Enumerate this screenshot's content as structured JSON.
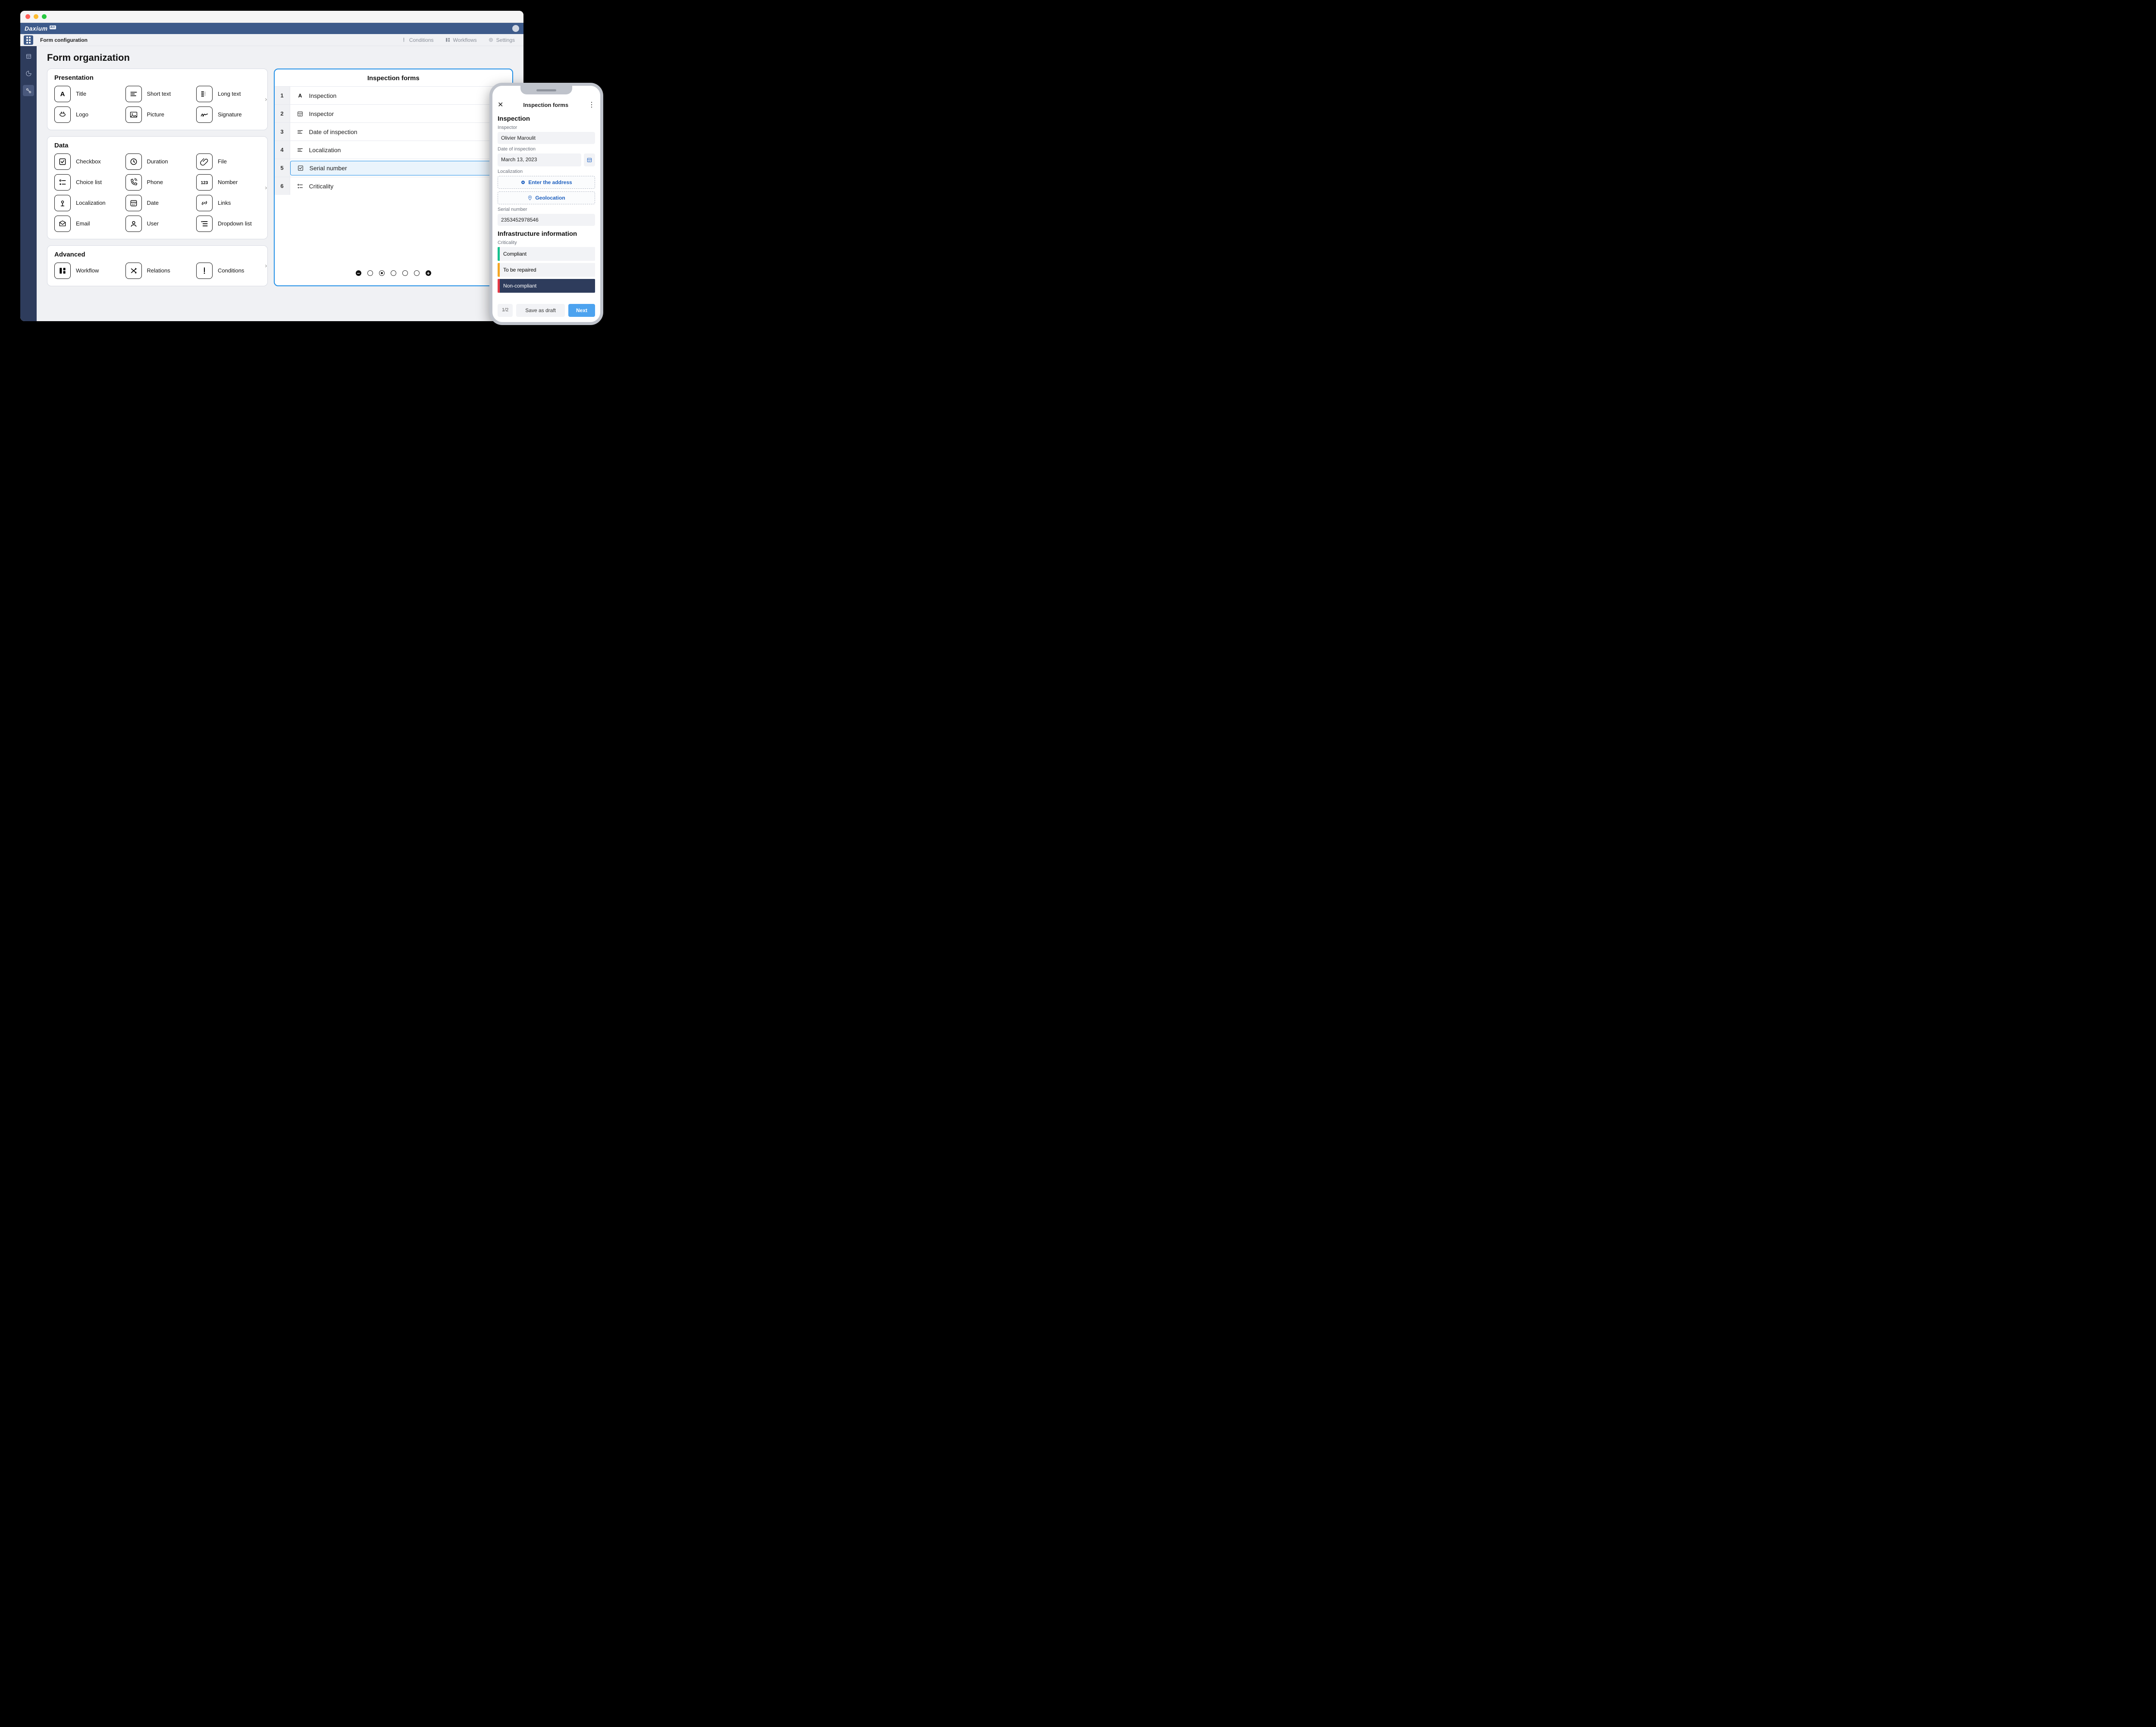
{
  "brand": {
    "name": "Daxium",
    "badge": "Air"
  },
  "toolbar": {
    "title": "Form configuration",
    "items": [
      {
        "label": "Conditions",
        "icon": "alert"
      },
      {
        "label": "Workflows",
        "icon": "workflow"
      },
      {
        "label": "Settings",
        "icon": "gear"
      }
    ]
  },
  "page_title": "Form organization",
  "cards": {
    "presentation": {
      "title": "Presentation",
      "items": [
        {
          "label": "Title",
          "icon": "A"
        },
        {
          "label": "Short text",
          "icon": "short"
        },
        {
          "label": "Long text",
          "icon": "long"
        },
        {
          "label": "Logo",
          "icon": "logo"
        },
        {
          "label": "Picture",
          "icon": "pic"
        },
        {
          "label": "Signature",
          "icon": "sig"
        }
      ]
    },
    "data": {
      "title": "Data",
      "items": [
        {
          "label": "Checkbox",
          "icon": "check"
        },
        {
          "label": "Duration",
          "icon": "clock"
        },
        {
          "label": "File",
          "icon": "clip"
        },
        {
          "label": "Choice list",
          "icon": "choice"
        },
        {
          "label": "Phone",
          "icon": "phone"
        },
        {
          "label": "Nomber",
          "icon": "num"
        },
        {
          "label": "Localization",
          "icon": "pin"
        },
        {
          "label": "Date",
          "icon": "date"
        },
        {
          "label": "Links",
          "icon": "link"
        },
        {
          "label": "Email",
          "icon": "mail"
        },
        {
          "label": "User",
          "icon": "user"
        },
        {
          "label": "Dropdown list",
          "icon": "dd"
        }
      ]
    },
    "advanced": {
      "title": "Advanced",
      "items": [
        {
          "label": "Workflow",
          "icon": "wf"
        },
        {
          "label": "Relations",
          "icon": "rel"
        },
        {
          "label": "Conditions",
          "icon": "cond"
        }
      ]
    }
  },
  "preview": {
    "title": "Inspection forms",
    "rows": [
      {
        "n": "1",
        "label": "Inspection",
        "icon": "A",
        "sel": false
      },
      {
        "n": "2",
        "label": "Inspector",
        "icon": "date",
        "sel": false
      },
      {
        "n": "3",
        "label": "Date of inspection",
        "icon": "short",
        "sel": false
      },
      {
        "n": "4",
        "label": "Localization",
        "icon": "short",
        "sel": false
      },
      {
        "n": "5",
        "label": "Serial number",
        "icon": "check",
        "sel": true
      },
      {
        "n": "6",
        "label": "Criticality",
        "icon": "choice",
        "sel": false
      }
    ]
  },
  "phone": {
    "title": "Inspection forms",
    "section1": "Inspection",
    "inspector_label": "Inspector",
    "inspector_value": "Olivier Maroulit",
    "date_label": "Date of inspection",
    "date_value": "March 13, 2023",
    "loc_label": "Localization",
    "loc_btn1": "Enter the address",
    "loc_btn2": "Geolocation",
    "serial_label": "Serial number",
    "serial_value": "2353452978546",
    "section2": "Infrastructure information",
    "crit_label": "Criticality",
    "crit": [
      {
        "label": "Compliant",
        "cls": "compliant"
      },
      {
        "label": "To be repaired",
        "cls": "repair"
      },
      {
        "label": "Non-compliant",
        "cls": "noncomp"
      }
    ],
    "page": "1/2",
    "draft": "Save as draft",
    "next": "Next"
  }
}
